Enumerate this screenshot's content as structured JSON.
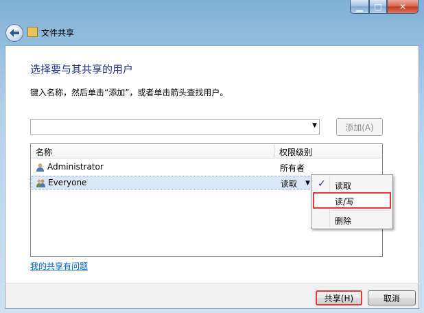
{
  "window": {
    "title": "文件共享",
    "controls": {
      "minimize": "▁",
      "maximize": "□",
      "close": "✕"
    }
  },
  "main": {
    "heading": "选择要与其共享的用户",
    "instruction": "键入名称，然后单击“添加”，或者单击箭头查找用户。",
    "add_button": "添加(A)",
    "columns": {
      "name": "名称",
      "permission": "权限级别"
    },
    "users": [
      {
        "name": "Administrator",
        "permission": "所有者"
      },
      {
        "name": "Everyone",
        "permission": "读取"
      }
    ],
    "problem_link": "我的共享有问题"
  },
  "permission_menu": {
    "items": [
      {
        "label": "读取",
        "checked": true
      },
      {
        "label": "读/写",
        "checked": false
      },
      {
        "label": "删除",
        "checked": false
      }
    ]
  },
  "footer": {
    "share_button": "共享(H)",
    "cancel_button": "取消"
  },
  "icons": {
    "back": "back-arrow-icon",
    "window": "share-folder-icon",
    "user": "user-icon",
    "group": "group-icon",
    "dropdown": "chevron-down-icon",
    "check": "check-icon"
  },
  "colors": {
    "heading": "#1e3287",
    "link": "#0066cc",
    "highlight_box": "#e03a3a",
    "selected_row": "#dbe8f9"
  }
}
